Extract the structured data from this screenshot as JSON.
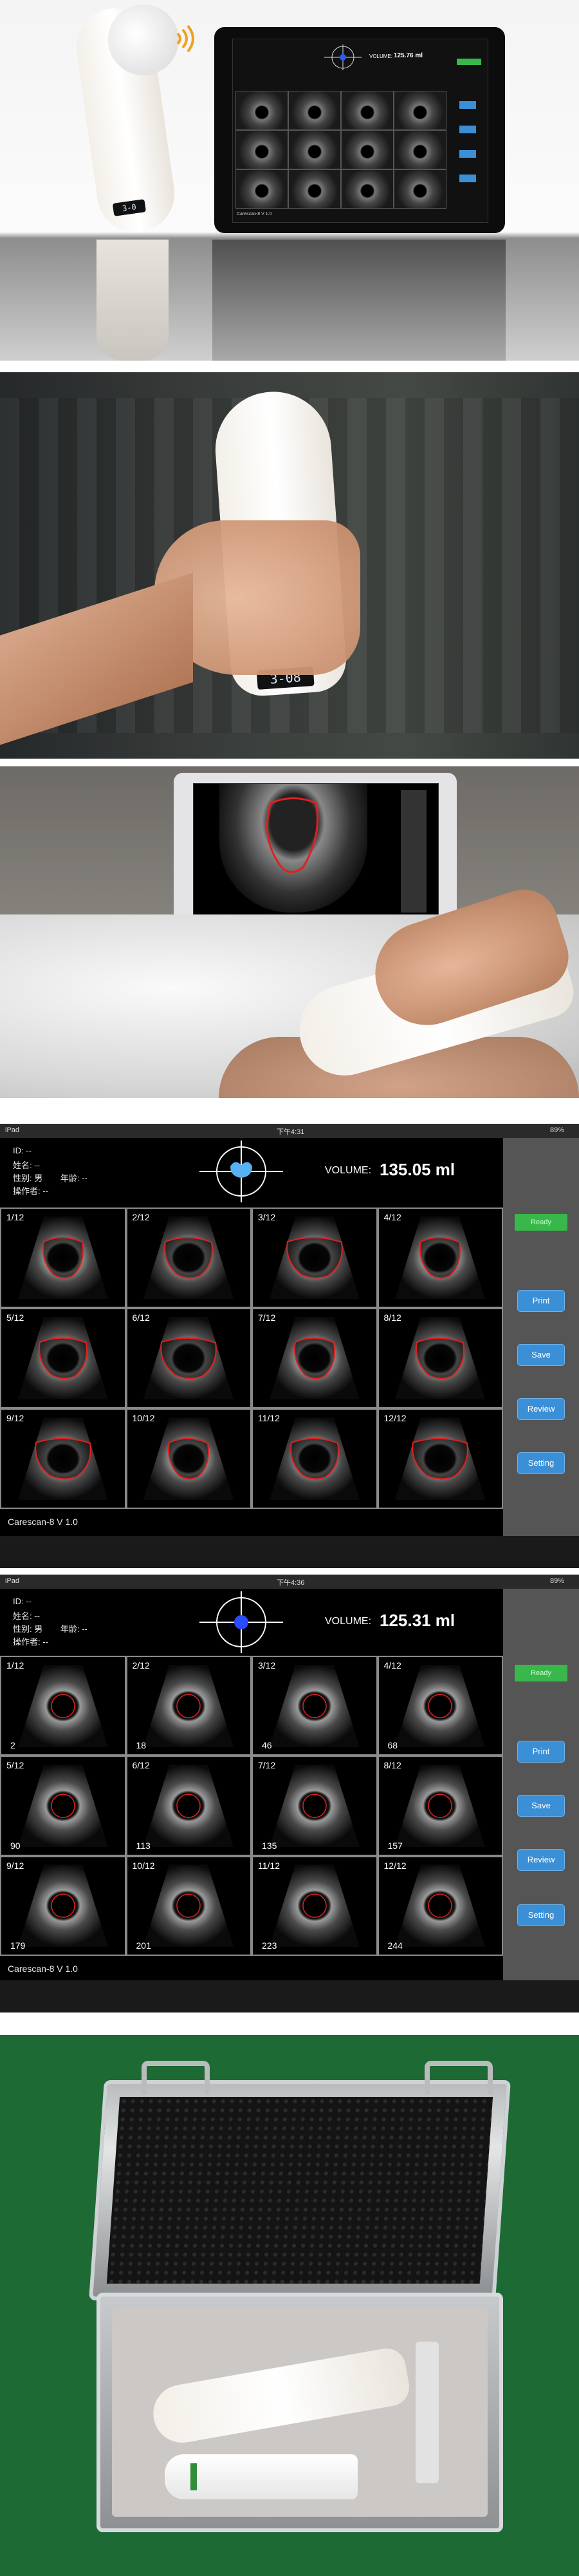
{
  "panel1": {
    "device_screen_text": "3-0",
    "tablet": {
      "volume_label": "VOLUME:",
      "volume_value": "125.76 ml",
      "footer": "Carescan-8 V 1.0"
    }
  },
  "panel2": {
    "device_screen_text": "3-08"
  },
  "panel4": {
    "status": {
      "left": "iPad",
      "time": "下午4:31",
      "right": "89%"
    },
    "patient": [
      {
        "label": "ID:",
        "value": "--"
      },
      {
        "label": "姓名:",
        "value": "--"
      },
      {
        "label": "性别:",
        "value": "男",
        "extra_label": "年龄:",
        "extra_value": "--"
      },
      {
        "label": "操作者:",
        "value": "--"
      }
    ],
    "volume_label": "VOLUME:",
    "volume_value": "135.05 ml",
    "ready_label": "Ready",
    "buttons": [
      "Print",
      "Save",
      "Review",
      "Setting"
    ],
    "cells": [
      {
        "label": "1/12"
      },
      {
        "label": "2/12"
      },
      {
        "label": "3/12"
      },
      {
        "label": "4/12"
      },
      {
        "label": "5/12"
      },
      {
        "label": "6/12"
      },
      {
        "label": "7/12"
      },
      {
        "label": "8/12"
      },
      {
        "label": "9/12"
      },
      {
        "label": "10/12"
      },
      {
        "label": "11/12"
      },
      {
        "label": "12/12"
      }
    ],
    "footer": "Carescan-8 V 1.0"
  },
  "panel5": {
    "status": {
      "left": "iPad",
      "time": "下午4:36",
      "right": "89%"
    },
    "patient": [
      {
        "label": "ID:",
        "value": "--"
      },
      {
        "label": "姓名:",
        "value": "--"
      },
      {
        "label": "性别:",
        "value": "男",
        "extra_label": "年龄:",
        "extra_value": "--"
      },
      {
        "label": "操作者:",
        "value": "--"
      }
    ],
    "volume_label": "VOLUME:",
    "volume_value": "125.31 ml",
    "ready_label": "Ready",
    "buttons": [
      "Print",
      "Save",
      "Review",
      "Setting"
    ],
    "cells": [
      {
        "label": "1/12",
        "value": "2"
      },
      {
        "label": "2/12",
        "value": "18"
      },
      {
        "label": "3/12",
        "value": "46"
      },
      {
        "label": "4/12",
        "value": "68"
      },
      {
        "label": "5/12",
        "value": "90"
      },
      {
        "label": "6/12",
        "value": "113"
      },
      {
        "label": "7/12",
        "value": "135"
      },
      {
        "label": "8/12",
        "value": "157"
      },
      {
        "label": "9/12",
        "value": "179"
      },
      {
        "label": "10/12",
        "value": "201"
      },
      {
        "label": "11/12",
        "value": "223"
      },
      {
        "label": "12/12",
        "value": "244"
      }
    ],
    "footer": "Carescan-8 V 1.0"
  },
  "colors": {
    "button_blue": "#3b8fd6",
    "ready_green": "#38b74a",
    "contour_red": "#e02020",
    "case_green": "#1d6a35"
  }
}
